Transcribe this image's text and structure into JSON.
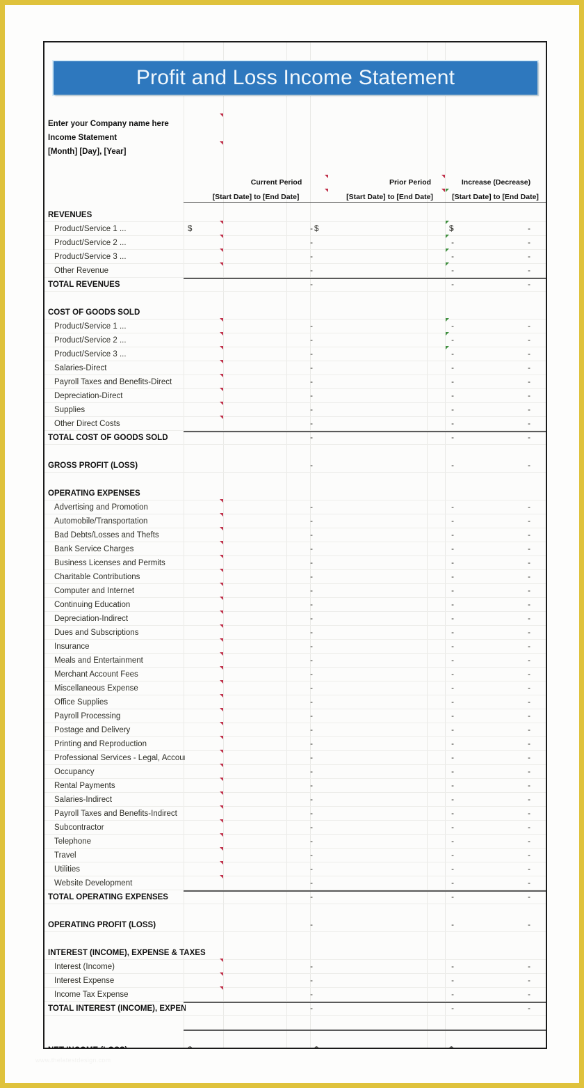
{
  "document": {
    "banner_title": "Profit and Loss Income Statement",
    "company_line": "Enter your Company name here",
    "statement_line": "Income Statement",
    "date_line": "[Month] [Day], [Year]",
    "watermark": "www.thelatestdesign.com"
  },
  "colors": {
    "banner_blue": "#2e78be",
    "banner_text": "#f0f7fc",
    "frame_gold": "#dfc23c",
    "sheet_border": "#1a1a1a",
    "rule": "#5a5a5a",
    "comment_red": "#c0304a",
    "comment_green": "#3f8f3f"
  },
  "columns": [
    {
      "title": "Current Period",
      "subtitle": "[Start Date] to [End Date]"
    },
    {
      "title": "Prior Period",
      "subtitle": "[Start Date] to [End Date]"
    },
    {
      "title": "Increase (Decrease)",
      "subtitle": "[Start Date] to [End Date]"
    }
  ],
  "symbols": {
    "dollar": "$",
    "dash": "-"
  },
  "sections": [
    {
      "heading": "REVENUES",
      "items": [
        {
          "label": "Product/Service 1 ...",
          "values": [
            "-",
            "-",
            "-"
          ],
          "dollar": true
        },
        {
          "label": "Product/Service 2 ...",
          "values": [
            "-",
            "-",
            "-"
          ]
        },
        {
          "label": "Product/Service 3 ...",
          "values": [
            "-",
            "-",
            "-"
          ]
        },
        {
          "label": "Other Revenue",
          "values": [
            "-",
            "-",
            "-"
          ]
        }
      ],
      "total": {
        "label": "TOTAL REVENUES",
        "values": [
          "-",
          "-",
          "-"
        ]
      }
    },
    {
      "heading": "COST OF GOODS SOLD",
      "items": [
        {
          "label": "Product/Service 1 ...",
          "values": [
            "-",
            "-",
            "-"
          ]
        },
        {
          "label": "Product/Service 2 ...",
          "values": [
            "-",
            "-",
            "-"
          ]
        },
        {
          "label": "Product/Service 3 ...",
          "values": [
            "-",
            "-",
            "-"
          ]
        },
        {
          "label": "Salaries-Direct",
          "values": [
            "-",
            "-",
            "-"
          ]
        },
        {
          "label": "Payroll Taxes and Benefits-Direct",
          "values": [
            "-",
            "-",
            "-"
          ]
        },
        {
          "label": "Depreciation-Direct",
          "values": [
            "-",
            "-",
            "-"
          ]
        },
        {
          "label": "Supplies",
          "values": [
            "-",
            "-",
            "-"
          ]
        },
        {
          "label": "Other Direct Costs",
          "values": [
            "-",
            "-",
            "-"
          ]
        }
      ],
      "total": {
        "label": "TOTAL COST OF GOODS SOLD",
        "values": [
          "-",
          "-",
          "-"
        ]
      }
    },
    {
      "subtotal": {
        "label": "GROSS PROFIT (LOSS)",
        "values": [
          "-",
          "-",
          "-"
        ]
      }
    },
    {
      "heading": "OPERATING EXPENSES",
      "items": [
        {
          "label": "Advertising and Promotion",
          "values": [
            "-",
            "-",
            "-"
          ]
        },
        {
          "label": "Automobile/Transportation",
          "values": [
            "-",
            "-",
            "-"
          ]
        },
        {
          "label": "Bad Debts/Losses and Thefts",
          "values": [
            "-",
            "-",
            "-"
          ]
        },
        {
          "label": "Bank Service Charges",
          "values": [
            "-",
            "-",
            "-"
          ]
        },
        {
          "label": "Business Licenses and Permits",
          "values": [
            "-",
            "-",
            "-"
          ]
        },
        {
          "label": "Charitable Contributions",
          "values": [
            "-",
            "-",
            "-"
          ]
        },
        {
          "label": "Computer and Internet",
          "values": [
            "-",
            "-",
            "-"
          ]
        },
        {
          "label": "Continuing Education",
          "values": [
            "-",
            "-",
            "-"
          ]
        },
        {
          "label": "Depreciation-Indirect",
          "values": [
            "-",
            "-",
            "-"
          ]
        },
        {
          "label": "Dues and Subscriptions",
          "values": [
            "-",
            "-",
            "-"
          ]
        },
        {
          "label": "Insurance",
          "values": [
            "-",
            "-",
            "-"
          ]
        },
        {
          "label": "Meals and Entertainment",
          "values": [
            "-",
            "-",
            "-"
          ]
        },
        {
          "label": "Merchant Account Fees",
          "values": [
            "-",
            "-",
            "-"
          ]
        },
        {
          "label": "Miscellaneous Expense",
          "values": [
            "-",
            "-",
            "-"
          ]
        },
        {
          "label": "Office Supplies",
          "values": [
            "-",
            "-",
            "-"
          ]
        },
        {
          "label": "Payroll Processing",
          "values": [
            "-",
            "-",
            "-"
          ]
        },
        {
          "label": "Postage and Delivery",
          "values": [
            "-",
            "-",
            "-"
          ]
        },
        {
          "label": "Printing and Reproduction",
          "values": [
            "-",
            "-",
            "-"
          ]
        },
        {
          "label": "Professional Services - Legal, Accounting",
          "values": [
            "-",
            "-",
            "-"
          ]
        },
        {
          "label": "Occupancy",
          "values": [
            "-",
            "-",
            "-"
          ]
        },
        {
          "label": "Rental Payments",
          "values": [
            "-",
            "-",
            "-"
          ]
        },
        {
          "label": "Salaries-Indirect",
          "values": [
            "-",
            "-",
            "-"
          ]
        },
        {
          "label": "Payroll Taxes and Benefits-Indirect",
          "values": [
            "-",
            "-",
            "-"
          ]
        },
        {
          "label": "Subcontractor",
          "values": [
            "-",
            "-",
            "-"
          ]
        },
        {
          "label": "Telephone",
          "values": [
            "-",
            "-",
            "-"
          ]
        },
        {
          "label": "Travel",
          "values": [
            "-",
            "-",
            "-"
          ]
        },
        {
          "label": "Utilities",
          "values": [
            "-",
            "-",
            "-"
          ]
        },
        {
          "label": "Website Development",
          "values": [
            "-",
            "-",
            "-"
          ]
        }
      ],
      "total": {
        "label": "TOTAL OPERATING EXPENSES",
        "values": [
          "-",
          "-",
          "-"
        ]
      }
    },
    {
      "subtotal": {
        "label": "OPERATING PROFIT (LOSS)",
        "values": [
          "-",
          "-",
          "-"
        ]
      }
    },
    {
      "heading": "INTEREST (INCOME), EXPENSE & TAXES",
      "items": [
        {
          "label": "Interest (Income)",
          "values": [
            "-",
            "-",
            "-"
          ]
        },
        {
          "label": "Interest Expense",
          "values": [
            "-",
            "-",
            "-"
          ]
        },
        {
          "label": "Income Tax Expense",
          "values": [
            "-",
            "-",
            "-"
          ]
        }
      ],
      "total": {
        "label": "TOTAL INTEREST (INCOME), EXPENSE & TAXES",
        "values": [
          "-",
          "-",
          "-"
        ]
      }
    }
  ],
  "net_income": {
    "label": "NET INCOME (LOSS)",
    "values": [
      "-",
      "-",
      "-"
    ],
    "dollar": true
  }
}
